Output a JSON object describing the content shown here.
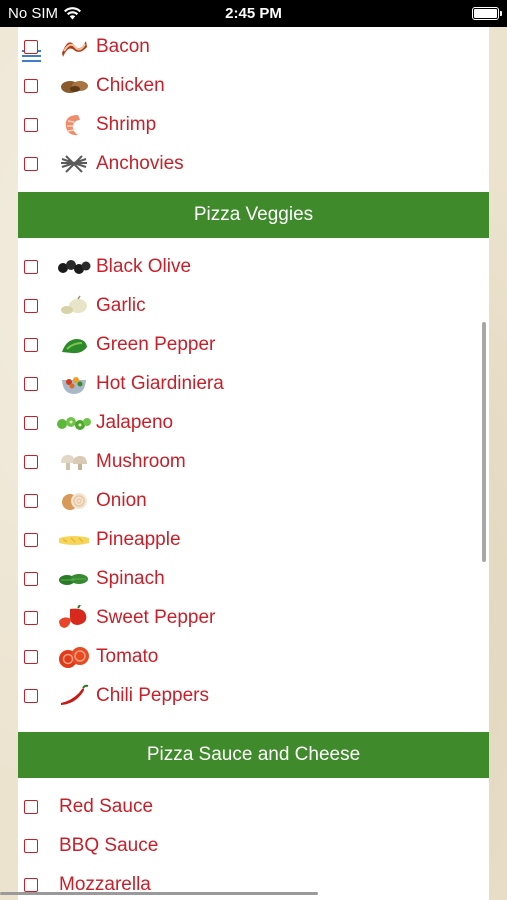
{
  "status_bar": {
    "carrier": "No SIM",
    "time": "2:45 PM"
  },
  "sections": {
    "meats": {
      "items": [
        {
          "label": "Bacon",
          "icon": "bacon-icon"
        },
        {
          "label": "Chicken",
          "icon": "chicken-icon"
        },
        {
          "label": "Shrimp",
          "icon": "shrimp-icon"
        },
        {
          "label": "Anchovies",
          "icon": "anchovies-icon"
        }
      ]
    },
    "veggies": {
      "title": "Pizza Veggies",
      "items": [
        {
          "label": "Black Olive",
          "icon": "black-olive-icon"
        },
        {
          "label": "Garlic",
          "icon": "garlic-icon"
        },
        {
          "label": "Green Pepper",
          "icon": "green-pepper-icon"
        },
        {
          "label": "Hot Giardiniera",
          "icon": "hot-giardiniera-icon"
        },
        {
          "label": "Jalapeno",
          "icon": "jalapeno-icon"
        },
        {
          "label": "Mushroom",
          "icon": "mushroom-icon"
        },
        {
          "label": "Onion",
          "icon": "onion-icon"
        },
        {
          "label": "Pineapple",
          "icon": "pineapple-icon"
        },
        {
          "label": "Spinach",
          "icon": "spinach-icon"
        },
        {
          "label": "Sweet Pepper",
          "icon": "sweet-pepper-icon"
        },
        {
          "label": "Tomato",
          "icon": "tomato-icon"
        },
        {
          "label": "Chili Peppers",
          "icon": "chili-peppers-icon"
        }
      ]
    },
    "sauce_cheese": {
      "title": "Pizza Sauce and Cheese",
      "items": [
        {
          "label": "Red Sauce"
        },
        {
          "label": "BBQ Sauce"
        },
        {
          "label": "Mozzarella"
        }
      ]
    }
  },
  "colors": {
    "accent": "#c8202a",
    "header_bg": "#3f8a2a",
    "menu_icon": "#3f7fc3"
  }
}
